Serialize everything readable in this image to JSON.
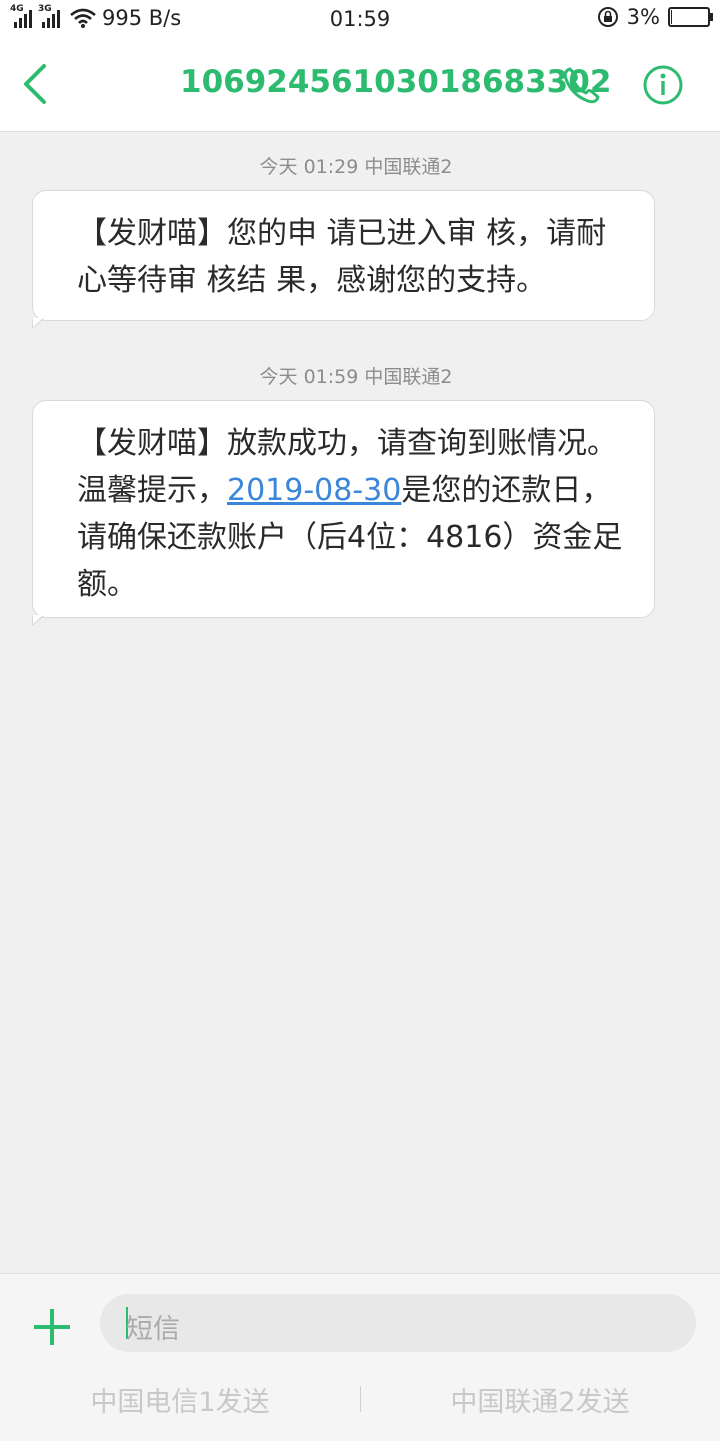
{
  "status_bar": {
    "net1": "4G",
    "net2": "3G",
    "speed": "995 B/s",
    "time": "01:59",
    "battery": "3%",
    "battery_level": 0.03
  },
  "header": {
    "title": "10692456103018683302"
  },
  "messages": [
    {
      "timestamp": "今天 01:29  中国联通2",
      "text": "【发财喵】您的申 请已进入审 核，请耐心等待审 核结 果，感谢您的支持。"
    },
    {
      "timestamp": "今天 01:59  中国联通2",
      "text_before": "【发财喵】放款成功，请查询到账情况。温馨提示，",
      "link": "2019-08-30",
      "text_after": "是您的还款日，请确保还款账户（后4位：4816）资金足额。"
    }
  ],
  "composer": {
    "placeholder": "短信",
    "send1": "中国电信1发送",
    "send2": "中国联通2发送"
  },
  "colors": {
    "accent": "#2dbb6f",
    "link": "#3a86d8",
    "background": "#f0f0f0"
  }
}
